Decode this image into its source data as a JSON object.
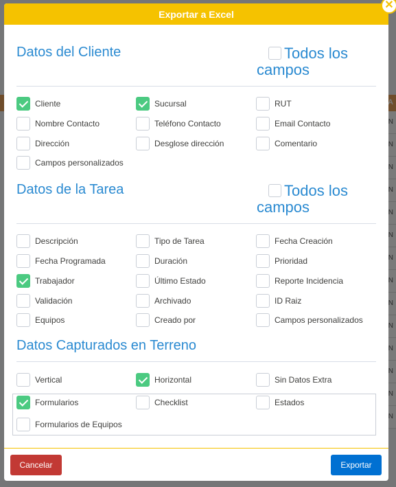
{
  "modal": {
    "title": "Exportar a Excel",
    "close_symbol": "✕"
  },
  "background": {
    "column_header": "TA",
    "cell_text": "SN"
  },
  "sections": {
    "cliente": {
      "title": "Datos del Cliente",
      "all_label": "Todos los campos",
      "all_checked": false,
      "rows": [
        [
          {
            "label": "Cliente",
            "checked": true
          },
          {
            "label": "Sucursal",
            "checked": true
          },
          {
            "label": "RUT",
            "checked": false
          }
        ],
        [
          {
            "label": "Nombre Contacto",
            "checked": false
          },
          {
            "label": "Teléfono Contacto",
            "checked": false
          },
          {
            "label": "Email Contacto",
            "checked": false
          }
        ],
        [
          {
            "label": "Dirección",
            "checked": false
          },
          {
            "label": "Desglose dirección",
            "checked": false
          },
          {
            "label": "Comentario",
            "checked": false
          }
        ],
        [
          {
            "label": "Campos personalizados",
            "checked": false
          }
        ]
      ]
    },
    "tarea": {
      "title": "Datos de la Tarea",
      "all_label": "Todos los campos",
      "all_checked": false,
      "rows": [
        [
          {
            "label": "Descripción",
            "checked": false
          },
          {
            "label": "Tipo de Tarea",
            "checked": false
          },
          {
            "label": "Fecha Creación",
            "checked": false
          }
        ],
        [
          {
            "label": "Fecha Programada",
            "checked": false
          },
          {
            "label": "Duración",
            "checked": false
          },
          {
            "label": "Prioridad",
            "checked": false
          }
        ],
        [
          {
            "label": "Trabajador",
            "checked": true
          },
          {
            "label": "Último Estado",
            "checked": false
          },
          {
            "label": "Reporte Incidencia",
            "checked": false
          }
        ],
        [
          {
            "label": "Validación",
            "checked": false
          },
          {
            "label": "Archivado",
            "checked": false
          },
          {
            "label": "ID Raiz",
            "checked": false
          }
        ],
        [
          {
            "label": "Equipos",
            "checked": false
          },
          {
            "label": "Creado por",
            "checked": false
          },
          {
            "label": "Campos personalizados",
            "checked": false
          }
        ]
      ]
    },
    "terreno": {
      "title": "Datos Capturados en Terreno",
      "rows": [
        [
          {
            "label": "Vertical",
            "checked": false
          },
          {
            "label": "Horizontal",
            "checked": true
          },
          {
            "label": "Sin Datos Extra",
            "checked": false
          }
        ],
        [
          {
            "label": "Formularios",
            "checked": true
          },
          {
            "label": "Checklist",
            "checked": false
          },
          {
            "label": "Estados",
            "checked": false
          }
        ],
        [
          {
            "label": "Formularios de Equipos",
            "checked": false
          }
        ]
      ]
    }
  },
  "footer": {
    "cancel_label": "Cancelar",
    "export_label": "Exportar"
  }
}
